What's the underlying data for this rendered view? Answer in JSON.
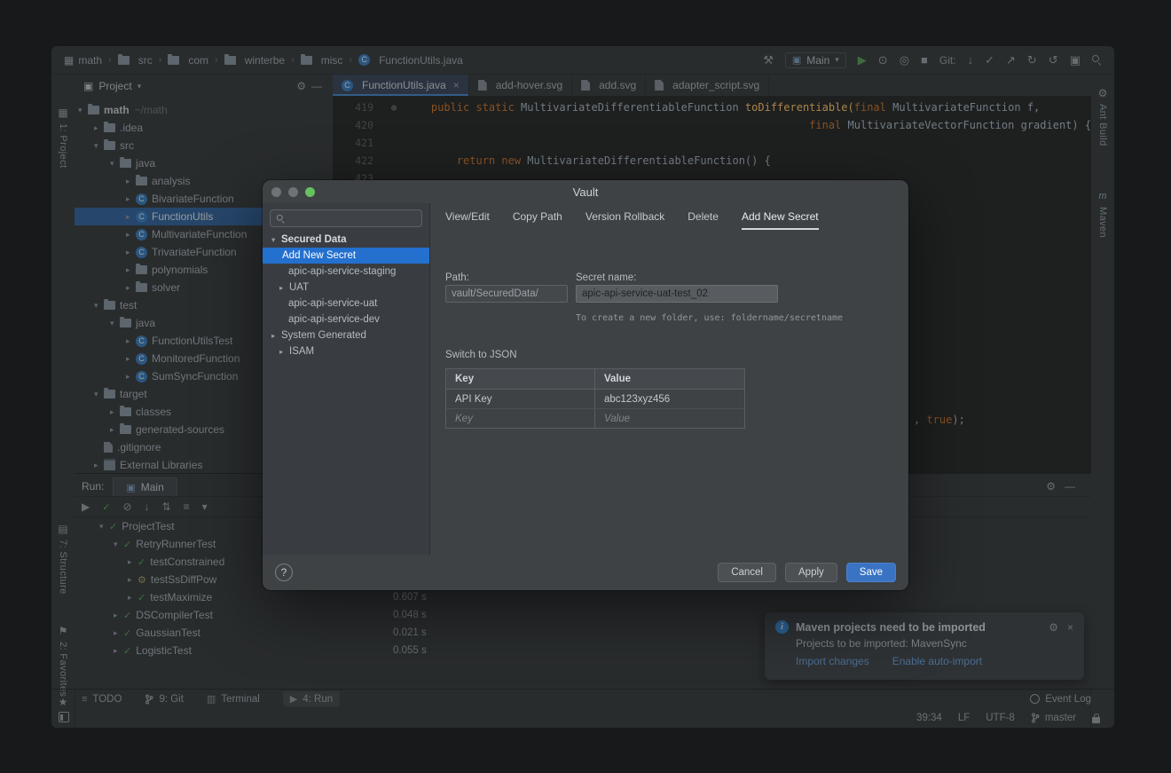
{
  "icons": {
    "chevron_down": "▾",
    "chevron_right": "▸",
    "close": "×",
    "gear": "⚙",
    "minimize": "―",
    "play": "▶",
    "check": "✓",
    "no_entry": "⊘",
    "sort_down": "↓",
    "sort_updown": "⇅",
    "menu": "≡",
    "hammer": "⚒",
    "debug": "⊙",
    "coverage": "◎",
    "stop": "■",
    "vcs_update": "↓",
    "vcs_commit": "✓",
    "vcs_push": "↗",
    "history": "↻",
    "rollback": "↺",
    "window": "▣",
    "module": "▦",
    "structure": "▤",
    "flag": "⚑",
    "star": "★",
    "maven_m": "m",
    "info": "i",
    "separator": "›",
    "gutter": "⊕",
    "terminal": "▥",
    "app": "▣"
  },
  "breadcrumbs": [
    "math",
    "src",
    "com",
    "winterbe",
    "misc",
    "FunctionUtils.java"
  ],
  "toolbar": {
    "run_config": "Main",
    "git_label": "Git:"
  },
  "stripes": {
    "project": "1: Project",
    "structure": "7: Structure",
    "favorites": "2: Favorites",
    "ant": "Ant Build",
    "maven": "Maven"
  },
  "project_panel": {
    "title": "Project",
    "tree": [
      {
        "label": "math",
        "suffix": "~/math",
        "arrow": "▾"
      },
      {
        "label": ".idea",
        "arrow": "▸"
      },
      {
        "label": "src",
        "arrow": "▾"
      },
      {
        "label": "java",
        "arrow": "▾"
      },
      {
        "label": "analysis",
        "arrow": "▸"
      },
      {
        "label": "BivariateFunction",
        "arrow": "▸"
      },
      {
        "label": "FunctionUtils",
        "arrow": "▸"
      },
      {
        "label": "MultivariateFunction",
        "arrow": "▸"
      },
      {
        "label": "TrivariateFunction",
        "arrow": "▸"
      },
      {
        "label": "polynomials",
        "arrow": "▸"
      },
      {
        "label": "solver",
        "arrow": "▸"
      },
      {
        "label": "test",
        "arrow": "▾"
      },
      {
        "label": "java",
        "arrow": "▾"
      },
      {
        "label": "FunctionUtilsTest",
        "arrow": "▸"
      },
      {
        "label": "MonitoredFunction",
        "arrow": "▸"
      },
      {
        "label": "SumSyncFunction",
        "arrow": "▸"
      },
      {
        "label": "target",
        "arrow": "▾"
      },
      {
        "label": "classes",
        "arrow": "▸"
      },
      {
        "label": "generated-sources",
        "arrow": "▸"
      },
      {
        "label": ".gitignore",
        "arrow": ""
      },
      {
        "label": "External Libraries",
        "arrow": "▸"
      }
    ]
  },
  "editor": {
    "tabs": [
      "FunctionUtils.java",
      "add-hover.svg",
      "add.svg",
      "adapter_script.svg"
    ],
    "lines": {
      "n419": "419",
      "n420": "420",
      "n421": "421",
      "n422": "422",
      "n423": "423",
      "l419": {
        "k1": "    public static ",
        "t1": "MultivariateDifferentiableFunction ",
        "m1": "toDifferentiable(",
        "k2": "final ",
        "t2": "MultivariateFunction ",
        "p1": "f,"
      },
      "l420": {
        "sp": "                                                               ",
        "k1": "final ",
        "t1": "MultivariateVectorFunction ",
        "p1": "gradient) {"
      },
      "l422": {
        "k1": "        return new ",
        "t1": "MultivariateDifferentiableFunction() {"
      }
    },
    "fragment": {
      "p1": ", ",
      "k1": "true",
      "p2": ");"
    }
  },
  "run_panel": {
    "label": "Run:",
    "tab": "Main",
    "tree": [
      {
        "label": "ProjectTest",
        "arrow": "▾",
        "time": ""
      },
      {
        "label": "RetryRunnerTest",
        "arrow": "▾",
        "time": ""
      },
      {
        "label": "testConstrained",
        "arrow": "▸",
        "time": ""
      },
      {
        "label": "testSsDiffPow",
        "arrow": "▸",
        "time": ""
      },
      {
        "label": "testMaximize",
        "arrow": "▸",
        "time": "0.607 s"
      },
      {
        "label": "DSCompilerTest",
        "arrow": "▸",
        "time": "0.048 s"
      },
      {
        "label": "GaussianTest",
        "arrow": "▸",
        "time": "0.021 s"
      },
      {
        "label": "LogisticTest",
        "arrow": "▸",
        "time": "0.055 s"
      }
    ]
  },
  "notification": {
    "title": "Maven projects need to be imported",
    "body": "Projects to be imported: MavenSync",
    "action1": "Import changes",
    "action2": "Enable auto-import"
  },
  "status_bar": {
    "todo": "TODO",
    "git": "9: Git",
    "terminal": "Terminal",
    "run": "4: Run",
    "event_log": "Event Log",
    "caret": "39:34",
    "line_sep": "LF",
    "encoding": "UTF-8",
    "branch": "master"
  },
  "dialog": {
    "title": "Vault",
    "tree": [
      {
        "label": "Secured Data",
        "arrow": "▾"
      },
      {
        "label": "Add New Secret",
        "arrow": ""
      },
      {
        "label": "apic-api-service-staging",
        "arrow": ""
      },
      {
        "label": "UAT",
        "arrow": "▸"
      },
      {
        "label": "apic-api-service-uat",
        "arrow": ""
      },
      {
        "label": "apic-api-service-dev",
        "arrow": ""
      },
      {
        "label": "System Generated",
        "arrow": "▸"
      },
      {
        "label": "ISAM",
        "arrow": "▸"
      }
    ],
    "tabs": [
      "View/Edit",
      "Copy Path",
      "Version Rollback",
      "Delete",
      "Add New Secret"
    ],
    "form": {
      "path_label": "Path:",
      "path_value": "vault/SecuredData/",
      "secret_label": "Secret name:",
      "secret_value": "apic-api-service-uat-test_02",
      "helper": "To create a new folder, use: foldername/secretname",
      "switch_json": "Switch to JSON"
    },
    "table": {
      "col1": "Key",
      "col2": "Value",
      "r1c1": "API Key",
      "r1c2": "abc123xyz456",
      "r2c1": "Key",
      "r2c2": "Value"
    },
    "buttons": {
      "help": "?",
      "cancel": "Cancel",
      "apply": "Apply",
      "save": "Save"
    }
  }
}
